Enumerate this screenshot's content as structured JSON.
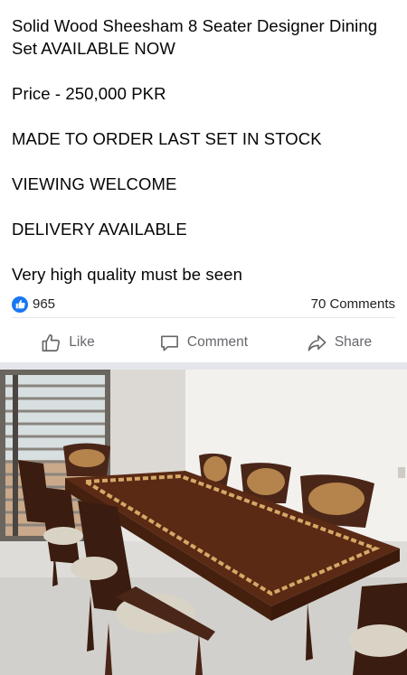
{
  "post": {
    "lines": [
      "Solid Wood Sheesham 8 Seater Designer Dining",
      "Set AVAILABLE NOW",
      "Price - 250,000 PKR",
      "MADE TO ORDER LAST SET IN STOCK",
      "VIEWING WELCOME",
      "DELIVERY AVAILABLE",
      "Very high quality must be seen"
    ]
  },
  "reactions": {
    "count": "965",
    "comments": "70 Comments",
    "icon": "like-icon",
    "accent": "#1877f2"
  },
  "actions": {
    "like_label": "Like",
    "comment_label": "Comment",
    "share_label": "Share"
  },
  "photo": {
    "subject": "dining set photo"
  }
}
